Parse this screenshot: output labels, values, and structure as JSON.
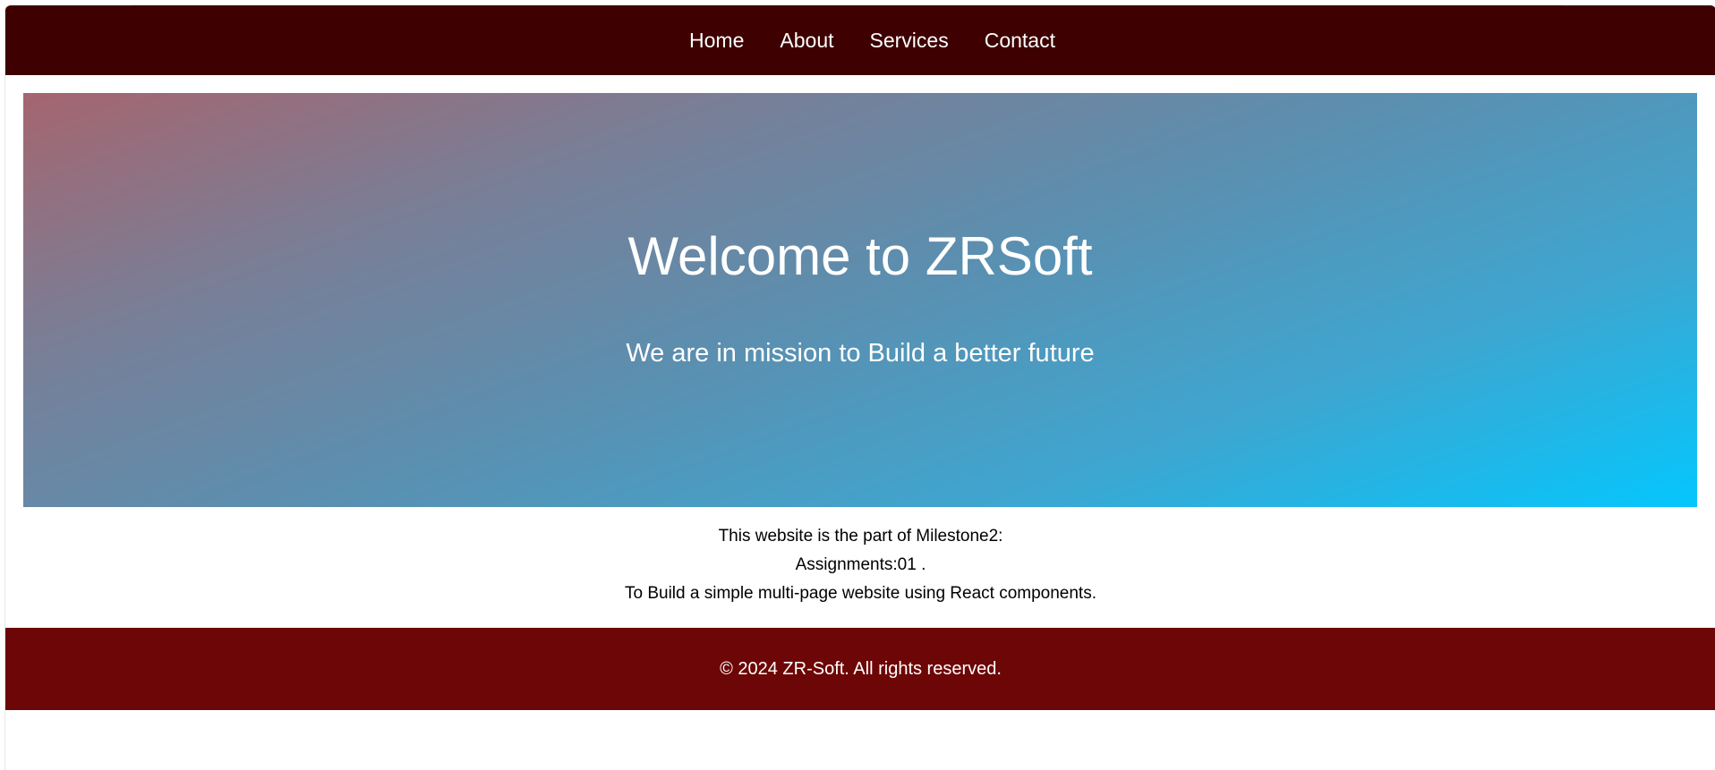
{
  "nav": {
    "items": [
      {
        "label": "Home"
      },
      {
        "label": "About"
      },
      {
        "label": "Services"
      },
      {
        "label": "Contact"
      }
    ]
  },
  "hero": {
    "title": "Welcome to ZRSoft",
    "subtitle": "We are in mission to Build a better future"
  },
  "info": {
    "line1": "This website is the part of Milestone2:",
    "line2": "Assignments:01 .",
    "line3": "To Build a simple multi-page website using React components."
  },
  "footer": {
    "text": "© 2024 ZR-Soft. All rights reserved."
  },
  "colors": {
    "navbar": "#3e0000",
    "footer": "#6d0606",
    "hero_gradient_start": "#a5656f",
    "hero_gradient_end": "#04c6fd"
  }
}
